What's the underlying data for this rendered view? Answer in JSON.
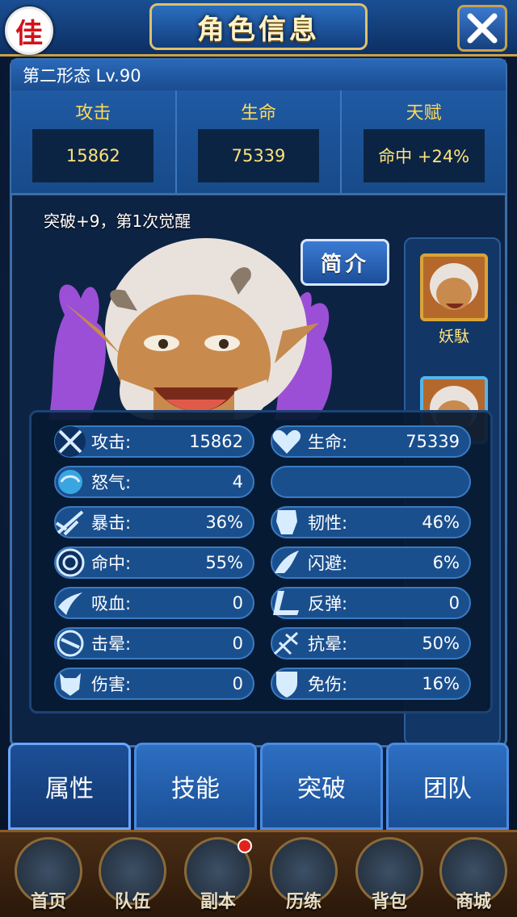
{
  "header": {
    "title": "角色信息",
    "server_badge": "佳"
  },
  "form": {
    "label": "第二形态  Lv.90"
  },
  "top_stats": [
    {
      "label": "攻击",
      "value": "15862"
    },
    {
      "label": "生命",
      "value": "75339"
    },
    {
      "label": "天赋",
      "value": "命中  +24%"
    }
  ],
  "breakthrough_text": "突破+9，第1次觉醒",
  "intro_button": "简介",
  "roster": [
    {
      "name": "妖駄"
    }
  ],
  "attributes": [
    {
      "label": "攻击:",
      "value": "15862",
      "icon": "crossed-swords-icon"
    },
    {
      "label": "生命:",
      "value": "75339",
      "icon": "heart-icon"
    },
    {
      "label": "怒气:",
      "value": "4",
      "icon": "swirl-orb-icon"
    },
    {
      "label": "",
      "value": "",
      "icon": ""
    },
    {
      "label": "暴击:",
      "value": "36%",
      "icon": "crit-slash-icon"
    },
    {
      "label": "韧性:",
      "value": "46%",
      "icon": "armor-icon"
    },
    {
      "label": "命中:",
      "value": "55%",
      "icon": "target-icon"
    },
    {
      "label": "闪避:",
      "value": "6%",
      "icon": "wing-icon"
    },
    {
      "label": "吸血:",
      "value": "0",
      "icon": "fang-icon"
    },
    {
      "label": "反弹:",
      "value": "0",
      "icon": "rebound-icon"
    },
    {
      "label": "击晕:",
      "value": "0",
      "icon": "stun-icon"
    },
    {
      "label": "抗晕:",
      "value": "50%",
      "icon": "resist-stun-icon"
    },
    {
      "label": "伤害:",
      "value": "0",
      "icon": "demon-mask-icon"
    },
    {
      "label": "免伤:",
      "value": "16%",
      "icon": "shield-icon"
    }
  ],
  "tabs": [
    {
      "label": "属性",
      "active": true
    },
    {
      "label": "技能",
      "active": false
    },
    {
      "label": "突破",
      "active": false
    },
    {
      "label": "团队",
      "active": false
    }
  ],
  "nav": [
    {
      "label": "首页"
    },
    {
      "label": "队伍"
    },
    {
      "label": "副本",
      "badge": true
    },
    {
      "label": "历练"
    },
    {
      "label": "背包"
    },
    {
      "label": "商城"
    }
  ]
}
